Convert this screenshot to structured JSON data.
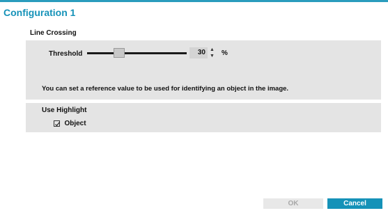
{
  "window": {
    "title": "Configuration 1",
    "accent_color": "#1592b8"
  },
  "line_crossing": {
    "heading": "Line Crossing",
    "threshold": {
      "label": "Threshold",
      "value": "30",
      "unit": "%",
      "slider_fraction": 0.3,
      "increment_icon": "caret-up-icon",
      "decrement_icon": "caret-down-icon"
    },
    "info_text": "You can set a reference value to be used for identifying an object in the image."
  },
  "use_highlight": {
    "label": "Use Highlight",
    "object_checkbox": {
      "label": "Object",
      "checked": true,
      "icon": "checkmark-icon"
    }
  },
  "footer": {
    "ok_label": "OK",
    "cancel_label": "Cancel"
  }
}
